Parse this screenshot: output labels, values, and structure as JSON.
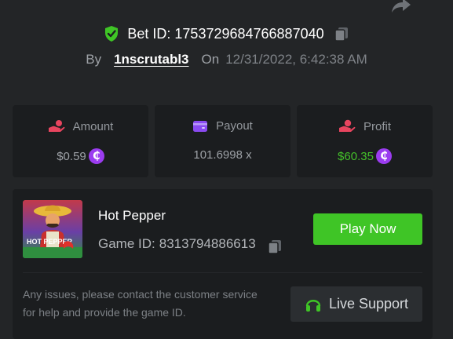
{
  "bet": {
    "label": "Bet ID:",
    "id": "1753729684766887040",
    "by_label": "By",
    "user": "1nscrutabl3",
    "on_label": "On",
    "datetime": "12/31/2022, 6:42:38 AM"
  },
  "stats": [
    {
      "name": "Amount",
      "value": "$0.59",
      "icon": "hand-coin-icon",
      "has_coin": true
    },
    {
      "name": "Payout",
      "value": "101.6998 x",
      "icon": "wallet-icon",
      "has_coin": false
    },
    {
      "name": "Profit",
      "value": "$60.35",
      "icon": "hand-money-icon",
      "has_coin": true
    }
  ],
  "currency_symbol": "₵",
  "game": {
    "name": "Hot Pepper",
    "id_label": "Game ID:",
    "id": "8313794886613",
    "thumb_text": "HOT PEPPER",
    "play_label": "Play Now"
  },
  "support": {
    "message": "Any issues, please contact the customer service for help and provide the game ID.",
    "button_label": "Live Support"
  },
  "colors": {
    "background": "#232527",
    "card": "#1b1d1f",
    "accent_green": "#3fc526",
    "profit_green": "#44c02a",
    "coin_purple": "#9b3cf0",
    "amount_icon": "#e8455f",
    "payout_icon": "#8a4af0",
    "profit_icon": "#e8455f"
  }
}
